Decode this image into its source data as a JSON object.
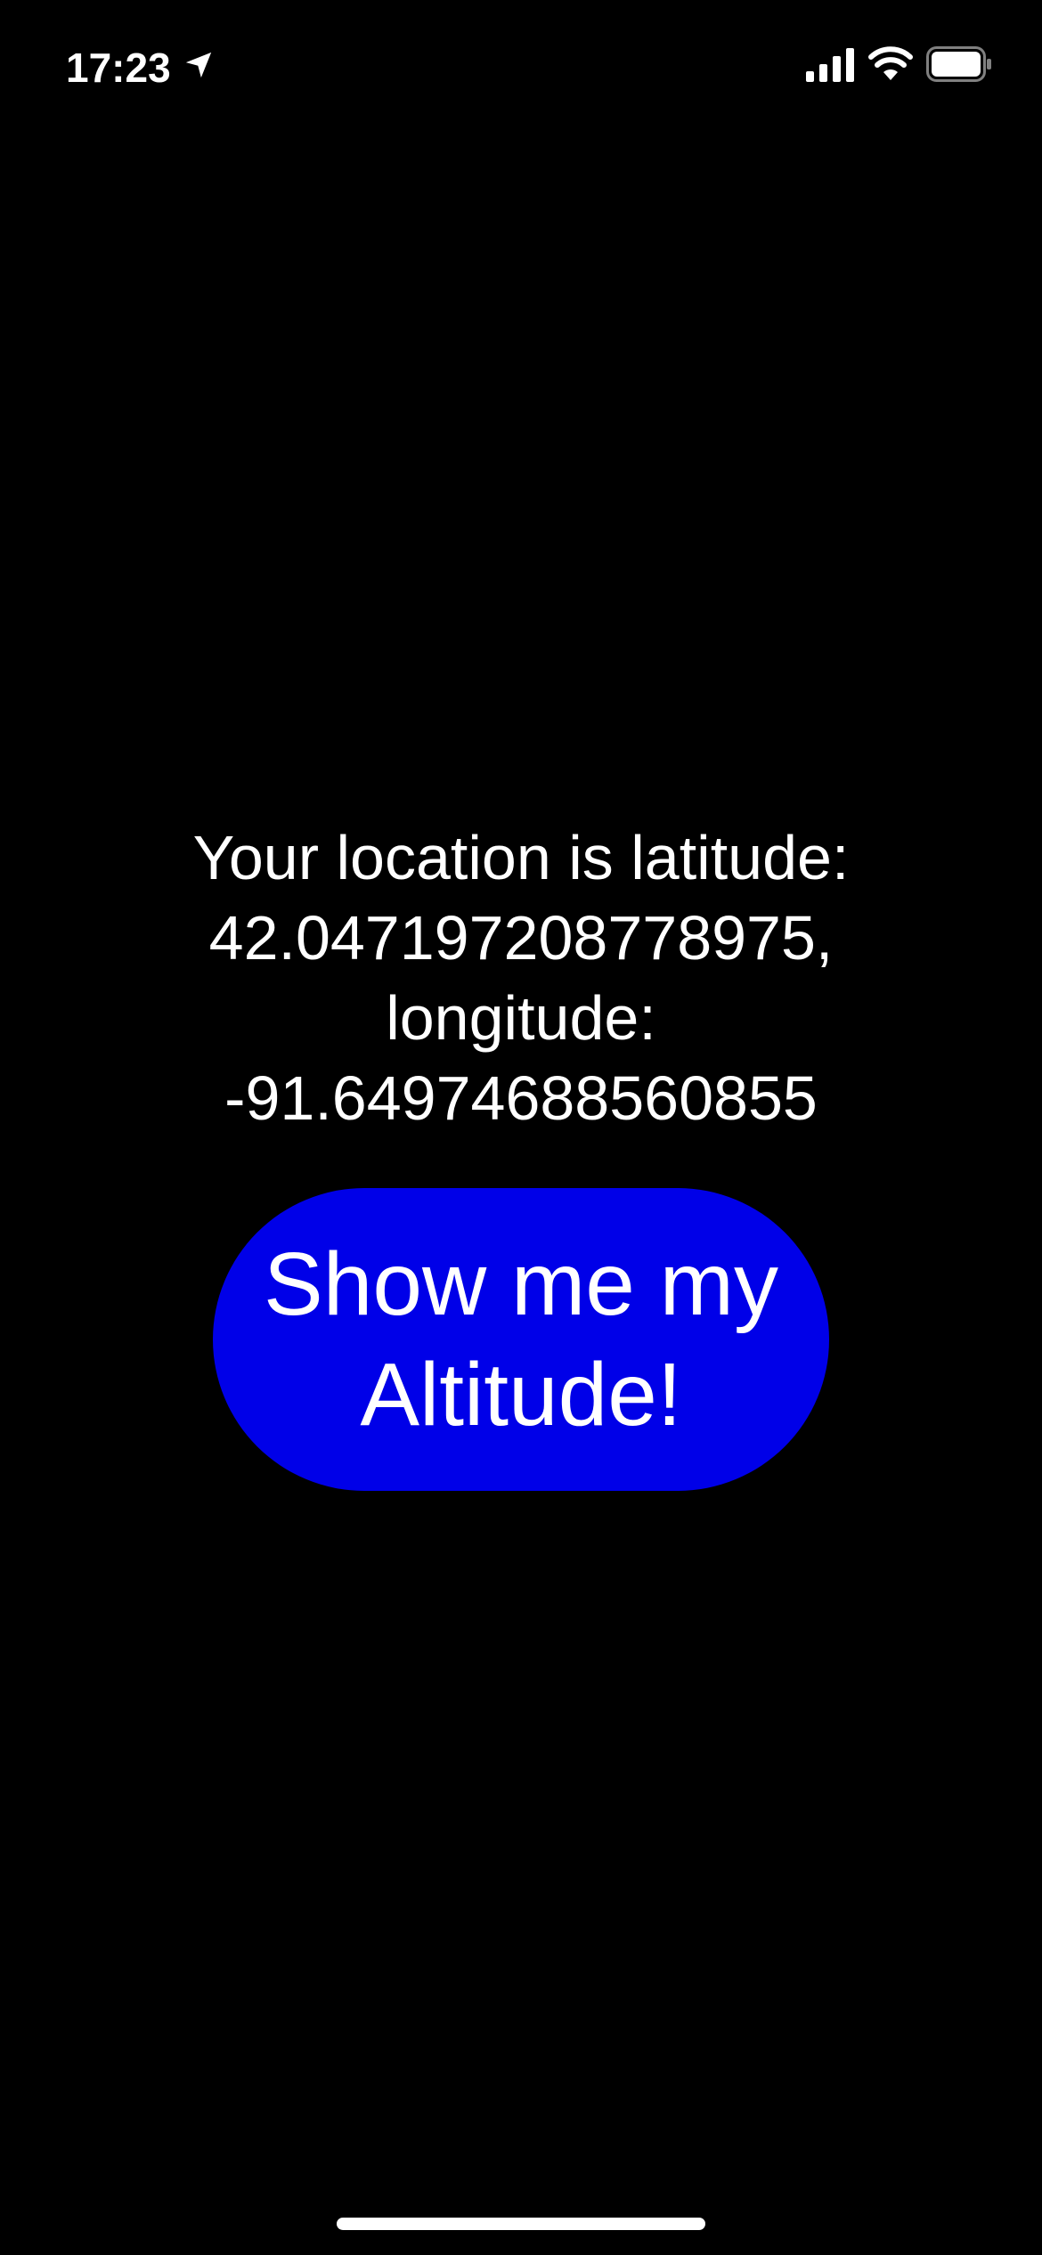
{
  "status_bar": {
    "time": "17:23",
    "icons": [
      "location-arrow-icon",
      "signal-icon",
      "wifi-icon",
      "battery-icon"
    ]
  },
  "location": {
    "line1": "Your location is latitude:",
    "latitude": "42.047197208778975,",
    "line3": "longitude:",
    "longitude": "-91.64974688560855"
  },
  "button": {
    "line1": "Show me my",
    "line2": "Altitude!"
  },
  "colors": {
    "background": "#000000",
    "text": "#ffffff",
    "button": "#0000e8"
  }
}
